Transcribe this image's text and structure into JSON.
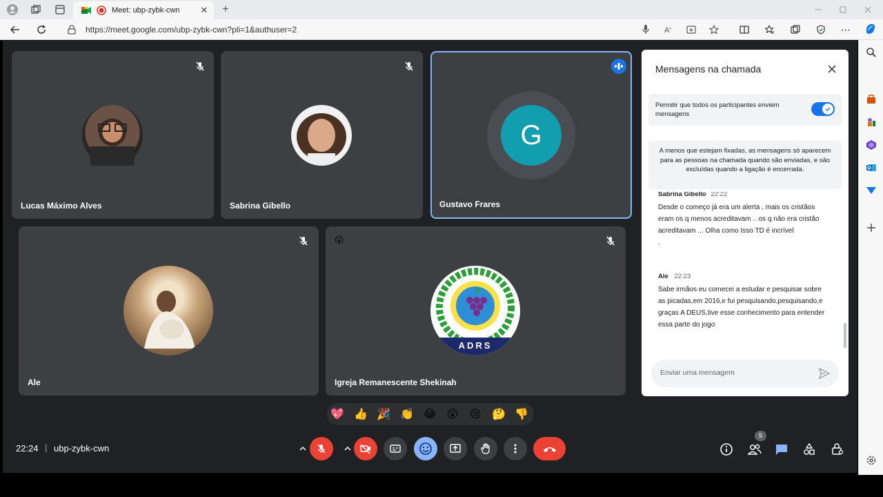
{
  "browser": {
    "tab_title": "Meet: ubp-zybk-cwn",
    "new_tab_symbol": "+",
    "url": "https://meet.google.com/ubp-zybk-cwn?pli=1&authuser=2"
  },
  "tiles": [
    {
      "name": "Lucas Máximo Alves"
    },
    {
      "name": "Sabrina Gibello"
    },
    {
      "name": "Gustavo Frares",
      "initial": "G"
    },
    {
      "name": "Ale"
    },
    {
      "name": "Igreja Remanescente Shekinah",
      "logo_text": "ADRS",
      "reaction": "😮"
    }
  ],
  "chat": {
    "title": "Mensagens na chamada",
    "toggle_label": "Permitir que todos os participantes enviem mensagens",
    "toggle_on": true,
    "notice": "A menos que estejam fixadas, as mensagens só aparecem para as pessoas na chamada quando são enviadas, e são excluídas quando a ligação é encerrada.",
    "messages": [
      {
        "author": "Sabrina Gibello",
        "time": "22:22",
        "text": "Desde o começo já era um alerta , mais os cristãos eram os q menos acreditavam .. os q não era cristão acreditavam ... Olha como Isso TD é incrível",
        "extra": "."
      },
      {
        "author": "Ale",
        "time": "22:23",
        "text": "Sabe irmãos eu comecei a estudar e pesquisar sobre as picadas,em 2016,e fui pesquisando,pesquisando,e graças  A DEUS,tive esse conhecimento para entender essa parte do jogo"
      }
    ],
    "input_placeholder": "Enviar uma mensagem"
  },
  "reactions": [
    "💖",
    "👍",
    "🎉",
    "👏",
    "😂",
    "😮",
    "😢",
    "🤔",
    "👎"
  ],
  "footer": {
    "time": "22:24",
    "separator": "|",
    "meeting_code": "ubp-zybk-cwn",
    "participants_count": "5"
  },
  "colors": {
    "meet_bg": "#202124",
    "tile_bg": "#3c4043",
    "red": "#ea4335",
    "blue": "#1a73e8",
    "avatar_teal": "#129eaf"
  }
}
